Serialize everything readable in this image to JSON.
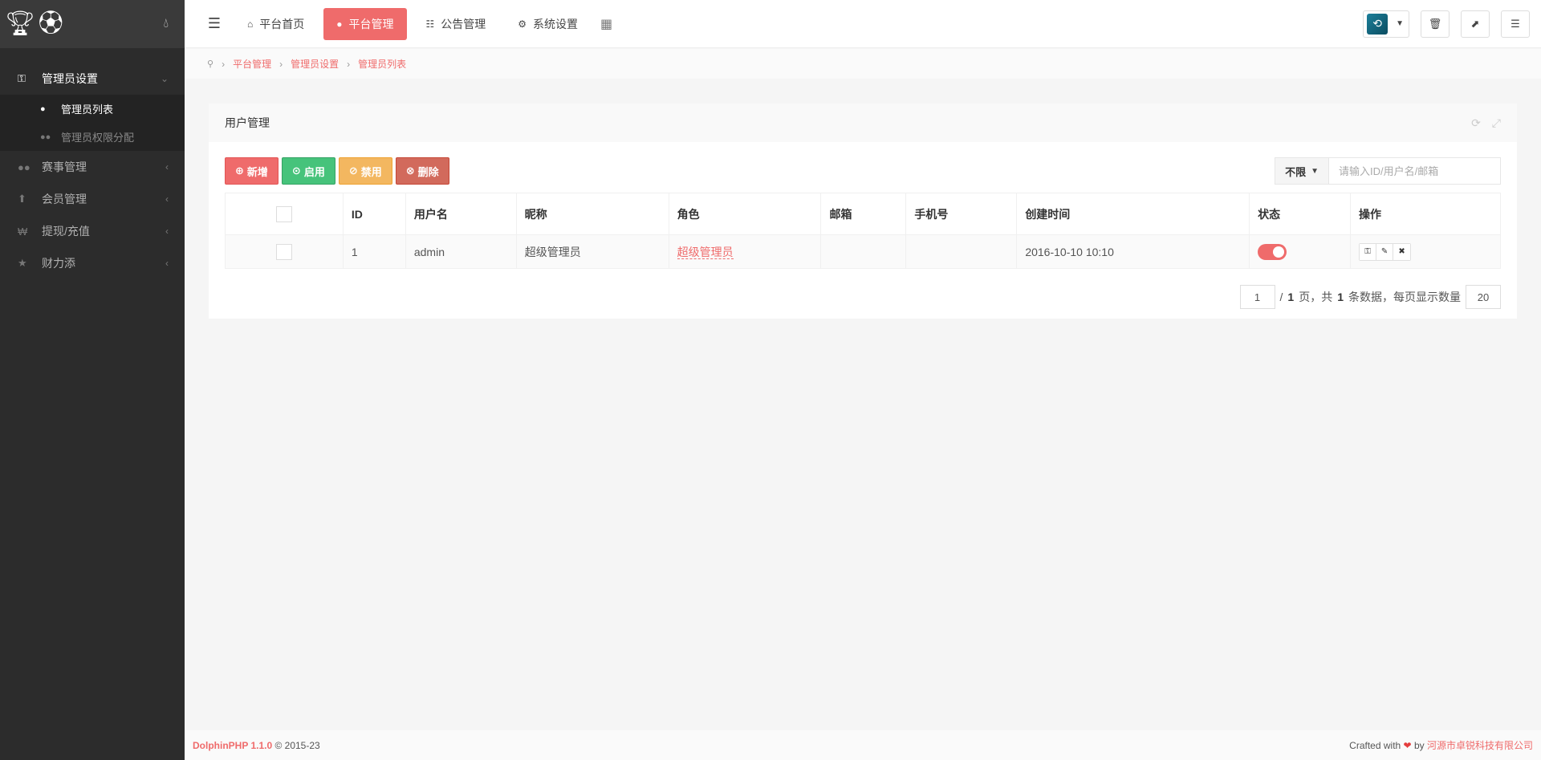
{
  "sidebar": {
    "logo_icons": [
      "trophy-icon",
      "soccer-ball-icon"
    ],
    "items": [
      {
        "label": "管理员设置",
        "icon": "key-icon",
        "open": true,
        "sub": [
          {
            "label": "管理员列表",
            "icon": "user-icon",
            "active": true
          },
          {
            "label": "管理员权限分配",
            "icon": "users-icon",
            "active": false
          }
        ]
      },
      {
        "label": "赛事管理",
        "icon": "users-icon"
      },
      {
        "label": "会员管理",
        "icon": "up-arrow-icon"
      },
      {
        "label": "提现/充值",
        "icon": "won-icon"
      },
      {
        "label": "财力添",
        "icon": "star-icon"
      }
    ]
  },
  "header": {
    "tabs": [
      {
        "label": "平台首页",
        "icon": "home-icon"
      },
      {
        "label": "平台管理",
        "icon": "user-icon",
        "active": true
      },
      {
        "label": "公告管理",
        "icon": "list-icon"
      },
      {
        "label": "系统设置",
        "icon": "gear-icon"
      }
    ]
  },
  "breadcrumb": [
    "平台管理",
    "管理员设置",
    "管理员列表"
  ],
  "panel": {
    "title": "用户管理",
    "buttons": {
      "add": "新增",
      "enable": "启用",
      "disable": "禁用",
      "delete": "删除"
    },
    "search": {
      "type": "不限",
      "placeholder": "请输入ID/用户名/邮箱"
    },
    "columns": [
      "ID",
      "用户名",
      "昵称",
      "角色",
      "邮箱",
      "手机号",
      "创建时间",
      "状态",
      "操作"
    ],
    "rows": [
      {
        "id": "1",
        "username": "admin",
        "nickname": "超级管理员",
        "role": "超级管理员",
        "email": "",
        "mobile": "",
        "created": "2016-10-10 10:10",
        "status": true
      }
    ],
    "pager": {
      "page": "1",
      "total_pages": "1",
      "sep": "/",
      "page_word": "页，共",
      "count": "1",
      "count_word": "条数据，每页显示数量",
      "per_page": "20"
    }
  },
  "footer": {
    "brand": "DolphinPHP 1.1.0",
    "copyright": "© 2015-23",
    "crafted": "Crafted with",
    "by": "by",
    "company": "河源市卓锐科技有限公司"
  },
  "colors": {
    "accent": "#ef6b6b",
    "success": "#46c37b",
    "warning": "#f3b760",
    "danger": "#d26a5c",
    "sidebar": "#2c2c2c"
  }
}
